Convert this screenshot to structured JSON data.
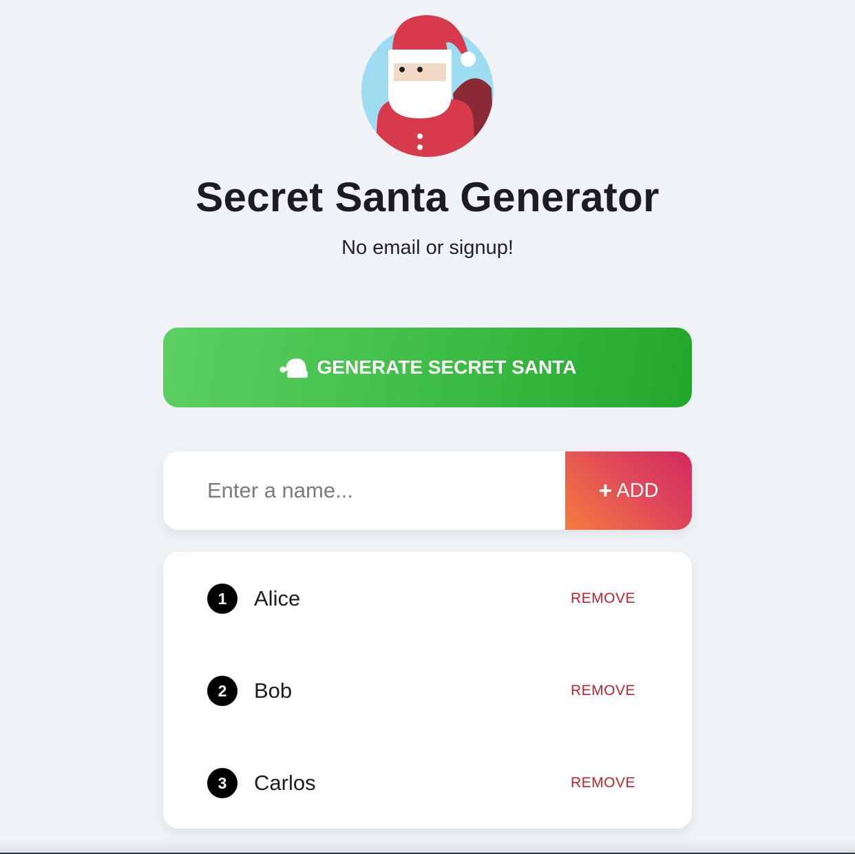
{
  "header": {
    "title": "Secret Santa Generator",
    "subtitle": "No email or signup!",
    "logo_icon": "santa-logo-icon"
  },
  "generate_button": {
    "label": "GENERATE SECRET SANTA",
    "icon": "santa-hat-icon"
  },
  "add_form": {
    "placeholder": "Enter a name...",
    "value": "",
    "add_label": "ADD",
    "add_icon": "plus-icon"
  },
  "participants": [
    {
      "number": "1",
      "name": "Alice",
      "action": "REMOVE"
    },
    {
      "number": "2",
      "name": "Bob",
      "action": "REMOVE"
    },
    {
      "number": "3",
      "name": "Carlos",
      "action": "REMOVE"
    }
  ],
  "colors": {
    "background": "#eff2f7",
    "generate_green": "#3fbe47",
    "add_gradient_start": "#f67d3e",
    "add_gradient_end": "#d12a5e",
    "remove_red": "#c4202c"
  }
}
